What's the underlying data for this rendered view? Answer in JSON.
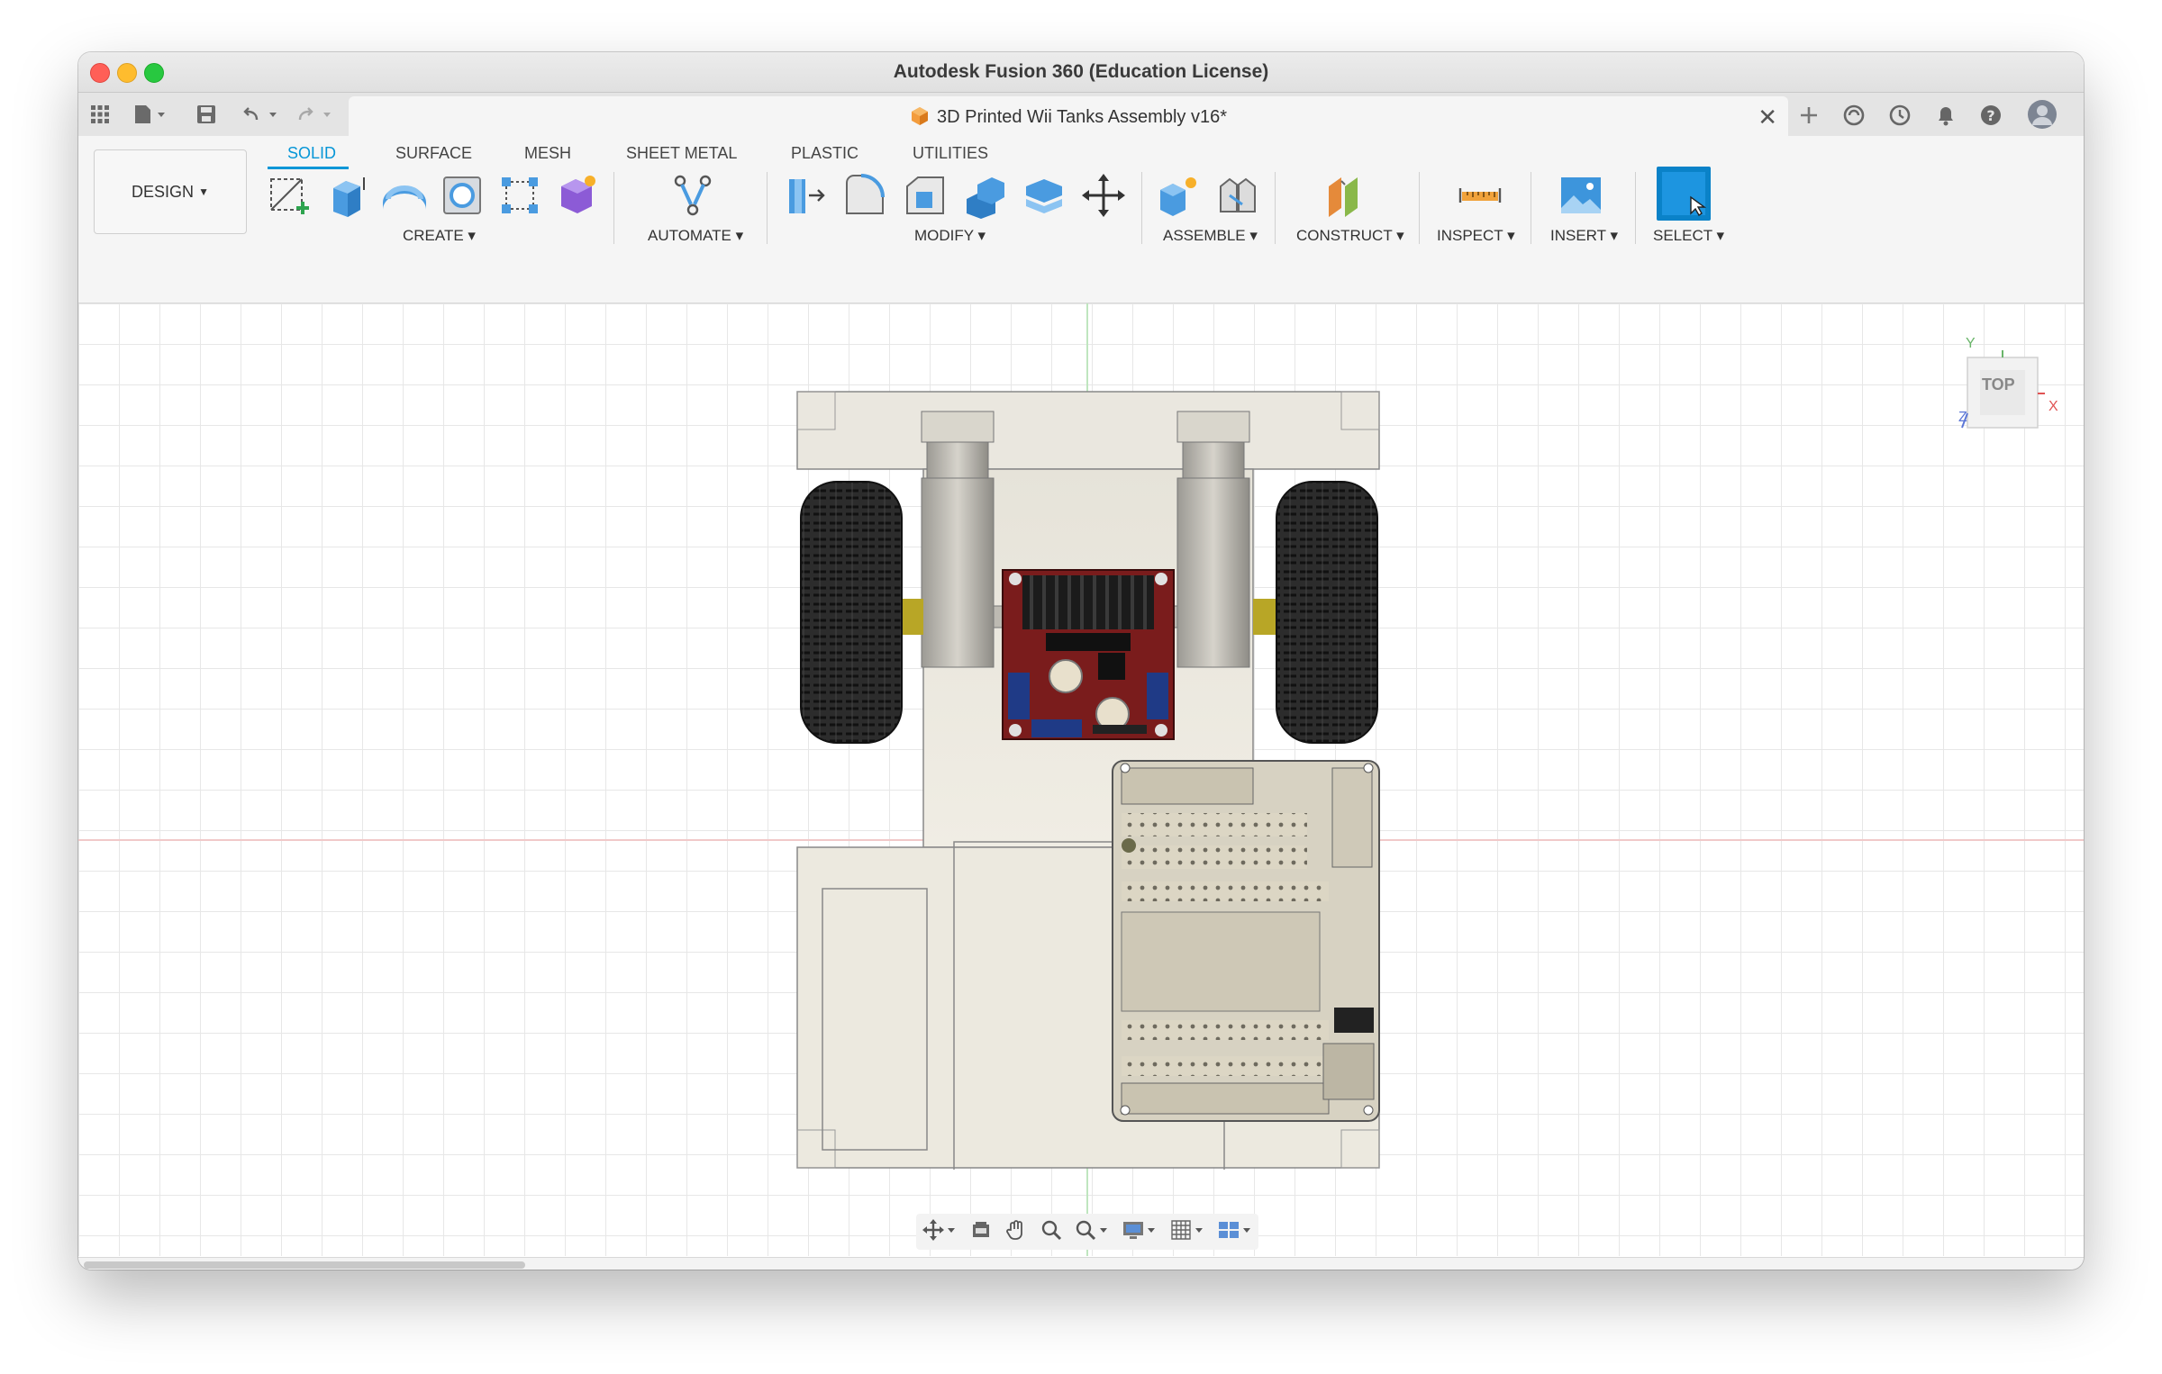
{
  "window": {
    "title": "Autodesk Fusion 360 (Education License)"
  },
  "document_tab": {
    "title": "3D Printed Wii Tanks Assembly v16*",
    "close_icon": "close-icon"
  },
  "workspace": {
    "label": "DESIGN"
  },
  "ribbon_tabs": [
    "SOLID",
    "SURFACE",
    "MESH",
    "SHEET METAL",
    "PLASTIC",
    "UTILITIES"
  ],
  "ribbon_active_tab": "SOLID",
  "tool_groups": {
    "create": "CREATE",
    "automate": "AUTOMATE",
    "modify": "MODIFY",
    "assemble": "ASSEMBLE",
    "construct": "CONSTRUCT",
    "inspect": "INSPECT",
    "insert": "INSERT",
    "select": "SELECT"
  },
  "viewcube": {
    "face": "TOP",
    "axis_y": "Y",
    "axis_x": "X",
    "axis_z": "Z"
  },
  "colors": {
    "accent": "#0696d7",
    "select_tool": "#0a82c8",
    "board_pcb": "#7a1c1c",
    "chassis": "#ebe7dc"
  },
  "timeline_feature_icons": [
    "joint",
    "joint",
    "sketch",
    "pin-sketch",
    "pin",
    "joint",
    "sketch",
    "joint",
    "joint",
    "joint",
    "sketch",
    "sketch",
    "joint",
    "joint",
    "joint",
    "sketch",
    "sketch",
    "joint",
    "joint",
    "joint",
    "joint",
    "joint",
    "joint",
    "joint",
    "joint",
    "joint",
    "joint",
    "joint",
    "joint",
    "joint",
    "joint",
    "joint",
    "joint",
    "joint",
    "joint",
    "joint",
    "joint",
    "joint",
    "joint",
    "joint",
    "joint",
    "joint",
    "joint",
    "joint",
    "joint",
    "sketch",
    "joint",
    "sketch",
    "joint",
    "joint",
    "joint",
    "joint"
  ]
}
